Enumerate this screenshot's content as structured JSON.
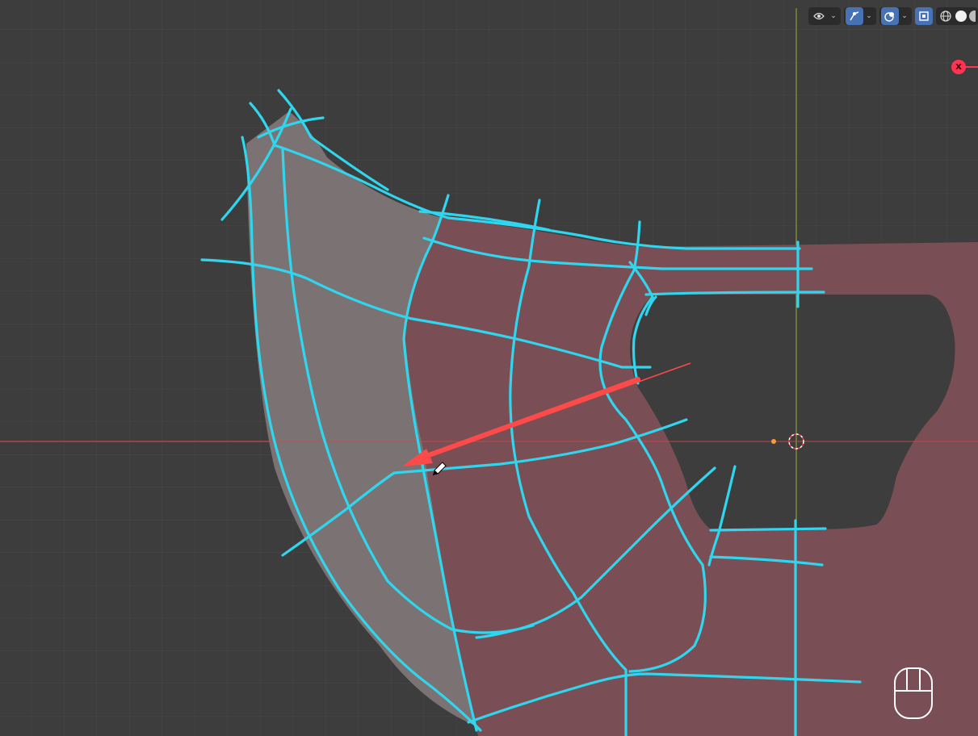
{
  "app": {
    "editor": "3D Viewport",
    "view": "orthographic-front"
  },
  "colors": {
    "background": "#3d3d3d",
    "grid_minor": "#464646",
    "grid_major": "#4f4f4f",
    "x_axis": "#d14a4a",
    "z_axis": "#87a13a",
    "mesh_selected_face": "#7a4e55",
    "mesh_unselected_face": "#7b7373",
    "annotation_stroke": "#2fd6ee",
    "arrow": "#ff4a4a",
    "header_active": "#4772b3"
  },
  "viewport_header": {
    "buttons": [
      {
        "name": "visibility-eye-icon",
        "active": false
      },
      {
        "name": "gizmo-toggle-icon",
        "active": true
      },
      {
        "name": "overlay-toggle-icon",
        "active": true
      },
      {
        "name": "xray-toggle-icon",
        "active": true
      },
      {
        "name": "wireframe-shading-icon",
        "active": false
      },
      {
        "name": "solid-shading-icon",
        "active": true
      },
      {
        "name": "material-shading-icon",
        "active": false
      }
    ]
  },
  "gizmo": {
    "x_label": "X"
  },
  "status": {
    "mouse_hint": "mouse-left-click-icon"
  }
}
